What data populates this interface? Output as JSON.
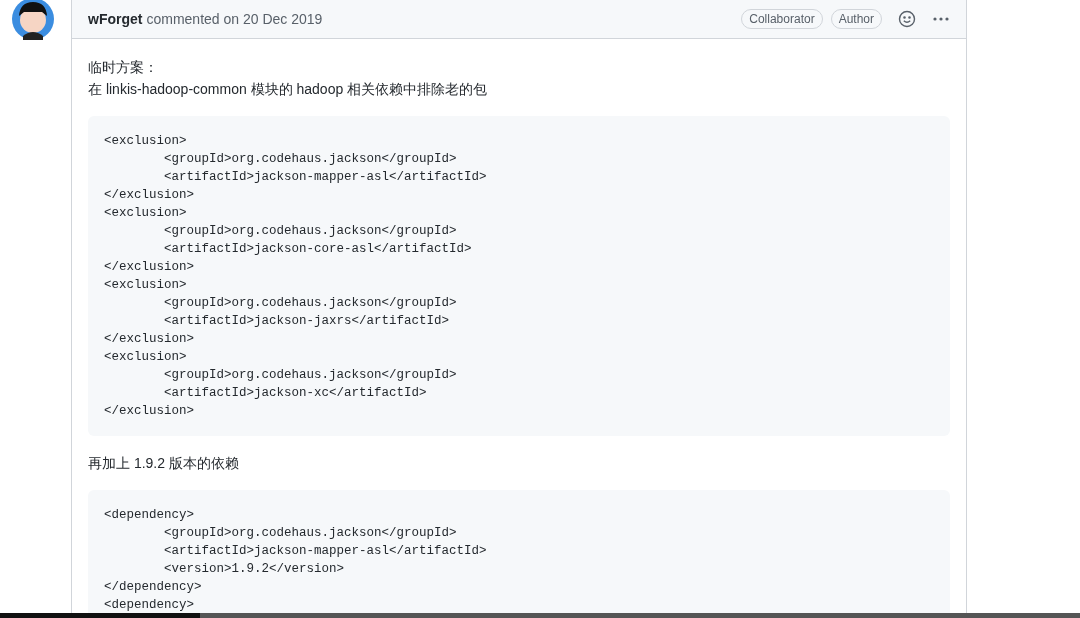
{
  "comment": {
    "author": "wForget",
    "meta": "commented on 20 Dec 2019",
    "badges": [
      "Collaborator",
      "Author"
    ],
    "body": [
      {
        "kind": "paragraph",
        "lines": [
          "临时方案：",
          "在 linkis-hadoop-common 模块的 hadoop 相关依赖中排除老的包"
        ]
      },
      {
        "kind": "code",
        "lines": [
          "<exclusion>",
          "        <groupId>org.codehaus.jackson</groupId>",
          "        <artifactId>jackson-mapper-asl</artifactId>",
          "</exclusion>",
          "<exclusion>",
          "        <groupId>org.codehaus.jackson</groupId>",
          "        <artifactId>jackson-core-asl</artifactId>",
          "</exclusion>",
          "<exclusion>",
          "        <groupId>org.codehaus.jackson</groupId>",
          "        <artifactId>jackson-jaxrs</artifactId>",
          "</exclusion>",
          "<exclusion>",
          "        <groupId>org.codehaus.jackson</groupId>",
          "        <artifactId>jackson-xc</artifactId>",
          "</exclusion>"
        ]
      },
      {
        "kind": "paragraph",
        "lines": [
          "再加上 1.9.2 版本的依赖"
        ]
      },
      {
        "kind": "code",
        "lines": [
          "<dependency>",
          "        <groupId>org.codehaus.jackson</groupId>",
          "        <artifactId>jackson-mapper-asl</artifactId>",
          "        <version>1.9.2</version>",
          "</dependency>",
          "<dependency>"
        ]
      }
    ]
  }
}
